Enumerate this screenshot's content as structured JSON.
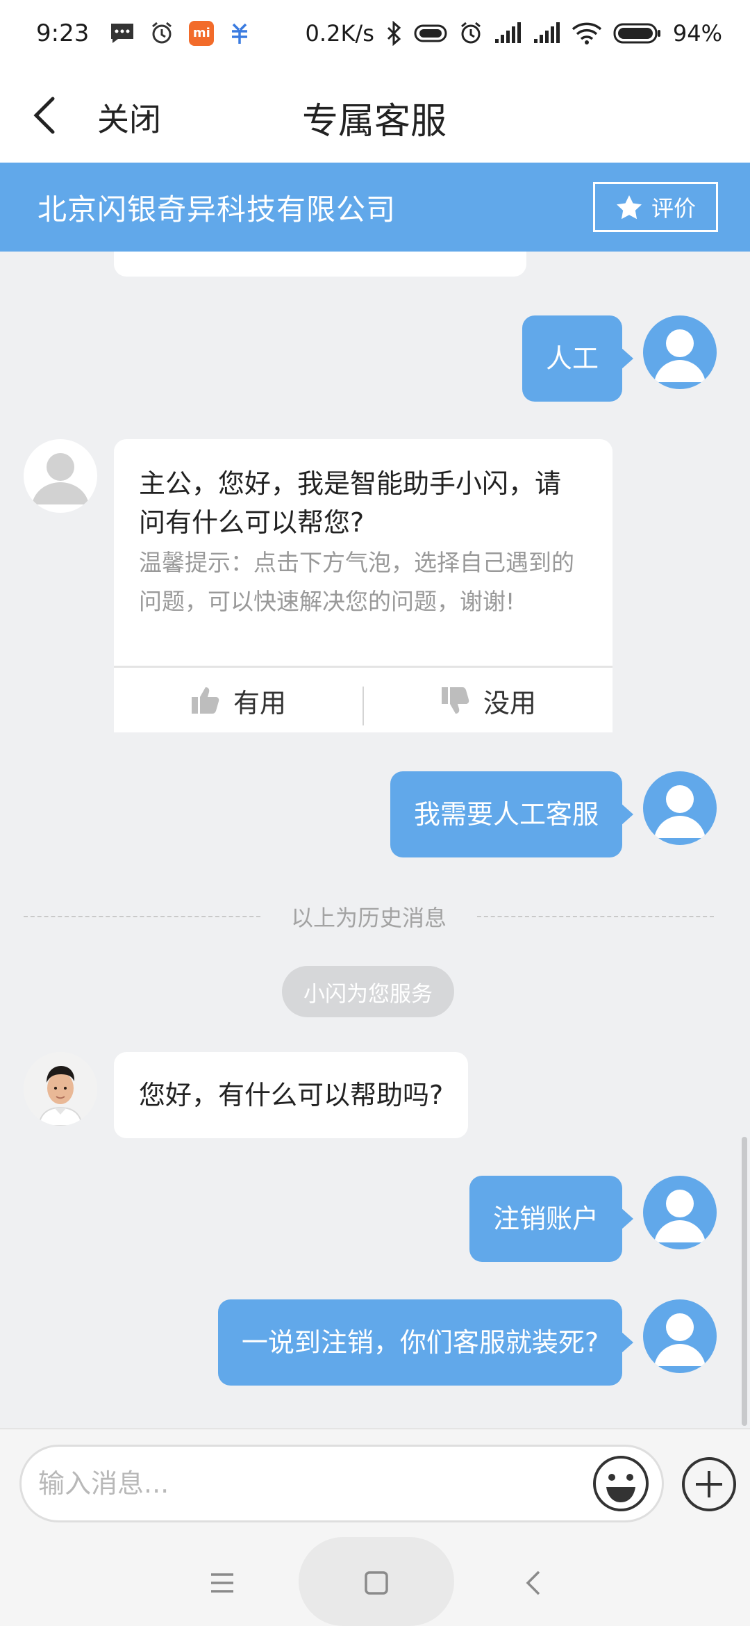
{
  "status_bar": {
    "time": "9:23",
    "net_speed": "0.2K/s",
    "battery": "94%",
    "mi_label": "mi",
    "icons": [
      "message-icon",
      "alarm-icon",
      "mi-app-icon",
      "app-icon",
      "bluetooth-icon",
      "vibrate-icon",
      "alarm-icon",
      "signal-icon",
      "signal-icon",
      "wifi-icon",
      "battery-icon"
    ]
  },
  "header": {
    "back_icon": "chevron-left-icon",
    "close_label": "关闭",
    "title": "专属客服"
  },
  "banner": {
    "company": "北京闪银奇异科技有限公司",
    "rate_label": "评价",
    "rate_icon": "star-icon"
  },
  "chat": {
    "messages": {
      "user_1": "人工",
      "bot_main": "主公，您好，我是智能助手小闪，请问有什么可以帮您?",
      "bot_tip": "温馨提示：点击下方气泡，选择自己遇到的问题，可以快速解决您的问题，谢谢!",
      "user_2": "我需要人工客服",
      "agent_1": "您好，有什么可以帮助吗?",
      "user_3": "注销账户",
      "user_4": "一说到注销，你们客服就装死?"
    },
    "feedback": {
      "useful": "有用",
      "useless": "没用"
    },
    "history_separator": "以上为历史消息",
    "service_notice": "小闪为您服务"
  },
  "input_bar": {
    "placeholder": "输入消息...",
    "emoji_icon": "emoji-icon",
    "plus_icon": "plus-icon"
  },
  "nav_bar": {
    "icons": [
      "menu-icon",
      "home-icon",
      "back-icon"
    ]
  },
  "colors": {
    "accent": "#61a8ea",
    "background": "#eff0f2",
    "bubble_agent": "#ffffff",
    "muted_text": "#999999"
  }
}
